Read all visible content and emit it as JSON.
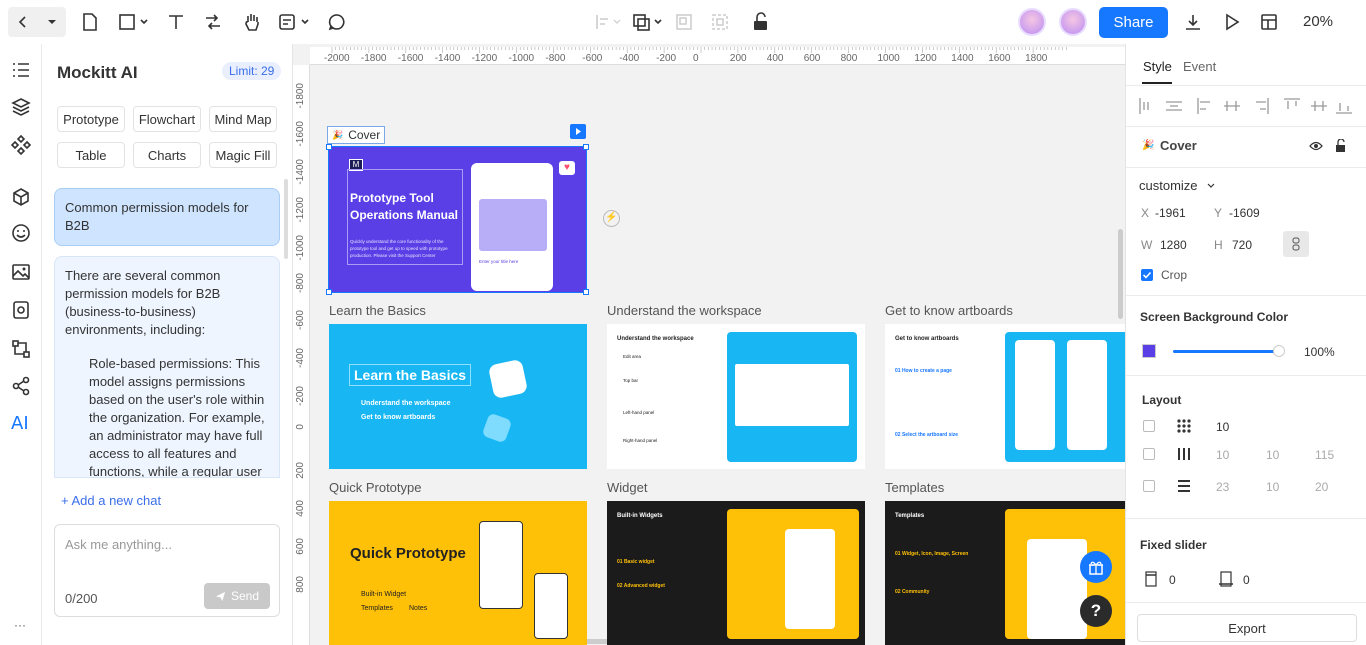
{
  "toolbar": {
    "share_label": "Share",
    "zoom": "20%"
  },
  "ai_panel": {
    "title": "Mockitt AI",
    "limit": "Limit: 29",
    "chips": [
      "Prototype",
      "Flowchart",
      "Mind Map",
      "Table",
      "Charts",
      "Magic Fill"
    ],
    "user_message": "Common permission models for B2B",
    "ai_message_intro": "There are several common permission models for B2B (business-to-business) environments, including:",
    "ai_message_item": "Role-based permissions: This model assigns permissions based on the user's role within the organization. For example, an administrator may have full access to all features and functions, while a regular user",
    "add_chat": "+ Add a new chat",
    "input_placeholder": "Ask me anything...",
    "char_count": "0/200",
    "send_label": "Send"
  },
  "canvas": {
    "ruler_h": [
      "-2000",
      "-1800",
      "-1600",
      "-1400",
      "-1200",
      "-1000",
      "-800",
      "-600",
      "-400",
      "-200",
      "0",
      "200",
      "400",
      "600",
      "800",
      "1000",
      "1200",
      "1400",
      "1600",
      "1800"
    ],
    "ruler_v": [
      "-1800",
      "-1600",
      "-1400",
      "-1200",
      "-1000",
      "-800",
      "-600",
      "-400",
      "-200",
      "0",
      "200",
      "400",
      "600",
      "800"
    ],
    "selected_label": "Cover",
    "cover": {
      "title": "Prototype Tool Operations Manual",
      "desc": "Quickly understand the core functionality of the prototype tool and get up to speed with prototype production. Please visit the Support Center",
      "card_title": "Enter your title here"
    },
    "boards": [
      {
        "label": "Learn the Basics",
        "title": "Learn the Basics",
        "items": [
          "Understand the workspace",
          "Get to know artboards"
        ]
      },
      {
        "label": "Understand the workspace",
        "title": "Understand the workspace",
        "items": [
          "Edit area",
          "Top bar",
          "Left-hand panel",
          "Right-hand panel"
        ]
      },
      {
        "label": "Get to know artboards",
        "title": "Get to know artboards",
        "items": [
          "01 How to create a page",
          "02 Select the artboard size"
        ]
      },
      {
        "label": "Quick Prototype",
        "title": "Quick Prototype",
        "items": [
          "Built-in Widget",
          "Templates",
          "Notes"
        ]
      },
      {
        "label": "Widget",
        "title": "Built-in Widgets",
        "items": [
          "01 Basic widget",
          "02 Advanced widget"
        ]
      },
      {
        "label": "Templates",
        "title": "Templates",
        "items": [
          "01 Widget, Icon, Image, Screen",
          "02 Community"
        ]
      }
    ]
  },
  "right_panel": {
    "tabs": [
      "Style",
      "Event"
    ],
    "element_name": "Cover",
    "mode": "customize",
    "x_label": "X",
    "x": "-1961",
    "y_label": "Y",
    "y": "-1609",
    "w_label": "W",
    "w": "1280",
    "h_label": "H",
    "h": "720",
    "crop_label": "Crop",
    "bg_title": "Screen Background Color",
    "bg_color": "#5b3fe6",
    "bg_opacity": "100%",
    "layout_title": "Layout",
    "grid": "10",
    "columns": [
      "10",
      "10",
      "115"
    ],
    "rows": [
      "23",
      "10",
      "20"
    ],
    "fixed_title": "Fixed slider",
    "fixed_top": "0",
    "fixed_bottom": "0",
    "export_label": "Export"
  },
  "colors": {
    "accent": "#1677ff",
    "cover_bg": "#5b3fe6",
    "board_blue": "#18b7f3",
    "board_yellow": "#ffc107",
    "board_dark": "#1b1b1b"
  }
}
